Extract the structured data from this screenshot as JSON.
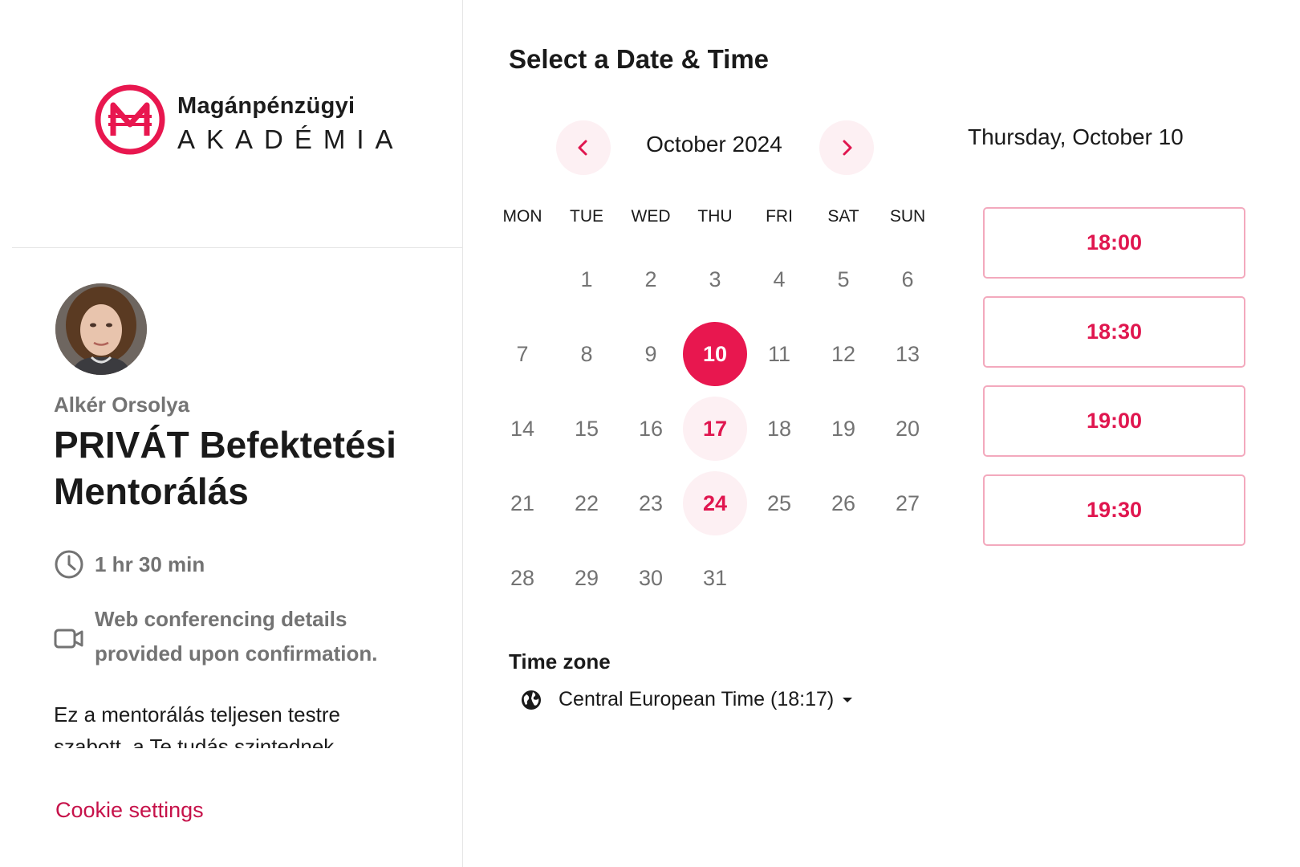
{
  "brand": {
    "name_top": "Magánpénzügyi",
    "name_bottom": "AKADÉMIA",
    "accent": "#e8174f"
  },
  "host": {
    "name": "Alkér Orsolya"
  },
  "event": {
    "title": "PRIVÁT Befektetési Mentorálás",
    "duration": "1 hr 30 min",
    "location": "Web conferencing details provided upon confirmation.",
    "description": "Ez a mentorálás teljesen testre szabott, a Te tudás szintednek"
  },
  "footer": {
    "cookie_link": "Cookie settings"
  },
  "calendar": {
    "heading": "Select a Date & Time",
    "month": "October 2024",
    "weekdays": [
      "MON",
      "TUE",
      "WED",
      "THU",
      "FRI",
      "SAT",
      "SUN"
    ],
    "days": [
      "1",
      "2",
      "3",
      "4",
      "5",
      "6",
      "7",
      "8",
      "9",
      "10",
      "11",
      "12",
      "13",
      "14",
      "15",
      "16",
      "17",
      "18",
      "19",
      "20",
      "21",
      "22",
      "23",
      "24",
      "25",
      "26",
      "27",
      "28",
      "29",
      "30",
      "31"
    ],
    "first_weekday_index": 1,
    "selected_day": "10",
    "available_days": [
      "10",
      "17",
      "24"
    ]
  },
  "timezone": {
    "heading": "Time zone",
    "value": "Central European Time (18:17)"
  },
  "slots": {
    "selected_date": "Thursday, October 10",
    "times": [
      "18:00",
      "18:30",
      "19:00",
      "19:30"
    ]
  },
  "icons": {
    "prev": "chevron-left-icon",
    "next": "chevron-right-icon",
    "duration": "clock-icon",
    "location": "video-camera-icon",
    "timezone": "globe-icon",
    "dropdown": "caret-down-icon"
  }
}
